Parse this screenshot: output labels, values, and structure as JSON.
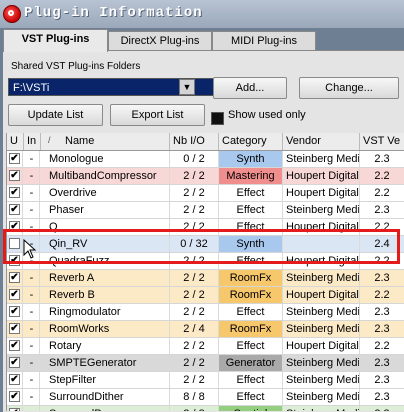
{
  "window": {
    "title": "Plug-in Information"
  },
  "tabs": [
    {
      "label": "VST Plug-ins",
      "active": true
    },
    {
      "label": "DirectX Plug-ins",
      "active": false
    },
    {
      "label": "MIDI Plug-ins",
      "active": false
    }
  ],
  "folders": {
    "label": "Shared VST Plug-ins Folders",
    "selected": "F:\\VSTi",
    "add_label": "Add...",
    "change_label": "Change..."
  },
  "toolbar": {
    "update_label": "Update List",
    "export_label": "Export List",
    "show_used_label": "Show used only"
  },
  "columns": [
    "U",
    "In",
    "Name",
    "Nb I/O",
    "Category",
    "Vendor",
    "VST Ve"
  ],
  "rows": [
    {
      "u": true,
      "in": "-",
      "name": "Monologue",
      "io": "0 / 2",
      "category": "Synth",
      "vendor": "Steinberg Media",
      "ver": "2.3",
      "row_bg": "#ffffff",
      "cat_bg": "#a8c8ee"
    },
    {
      "u": true,
      "in": "-",
      "name": "MultibandCompressor",
      "io": "2 / 2",
      "category": "Mastering",
      "vendor": "Houpert Digital A",
      "ver": "2.2",
      "row_bg": "#f8d7d7",
      "cat_bg": "#f08d8d"
    },
    {
      "u": true,
      "in": "-",
      "name": "Overdrive",
      "io": "2 / 2",
      "category": "Effect",
      "vendor": "Houpert Digital A",
      "ver": "2.2",
      "row_bg": "#ffffff",
      "cat_bg": "#ffffff"
    },
    {
      "u": true,
      "in": "-",
      "name": "Phaser",
      "io": "2 / 2",
      "category": "Effect",
      "vendor": "Steinberg Media",
      "ver": "2.3",
      "row_bg": "#ffffff",
      "cat_bg": "#ffffff"
    },
    {
      "u": true,
      "in": "-",
      "name": "Q",
      "io": "2 / 2",
      "category": "Effect",
      "vendor": "Houpert Digital A",
      "ver": "2.2",
      "row_bg": "#ffffff",
      "cat_bg": "#ffffff"
    },
    {
      "u": false,
      "in": "-",
      "name": "Qin_RV",
      "io": "0 / 32",
      "category": "Synth",
      "vendor": "",
      "ver": "2.4",
      "row_bg": "#dbe6f5",
      "cat_bg": "#a8c8ee"
    },
    {
      "u": true,
      "in": "-",
      "name": "QuadraFuzz",
      "io": "2 / 2",
      "category": "Effect",
      "vendor": "Houpert Digital A",
      "ver": "2.2",
      "row_bg": "#ffffff",
      "cat_bg": "#ffffff"
    },
    {
      "u": true,
      "in": "-",
      "name": "Reverb A",
      "io": "2 / 2",
      "category": "RoomFx",
      "vendor": "Steinberg Media",
      "ver": "2.3",
      "row_bg": "#fce9c6",
      "cat_bg": "#f7c76b"
    },
    {
      "u": true,
      "in": "-",
      "name": "Reverb B",
      "io": "2 / 2",
      "category": "RoomFx",
      "vendor": "Houpert Digital A",
      "ver": "2.2",
      "row_bg": "#fce9c6",
      "cat_bg": "#f7c76b"
    },
    {
      "u": true,
      "in": "-",
      "name": "Ringmodulator",
      "io": "2 / 2",
      "category": "Effect",
      "vendor": "Steinberg Media",
      "ver": "2.3",
      "row_bg": "#ffffff",
      "cat_bg": "#ffffff"
    },
    {
      "u": true,
      "in": "-",
      "name": "RoomWorks",
      "io": "2 / 4",
      "category": "RoomFx",
      "vendor": "Steinberg Media",
      "ver": "2.3",
      "row_bg": "#fce9c6",
      "cat_bg": "#f7c76b"
    },
    {
      "u": true,
      "in": "-",
      "name": "Rotary",
      "io": "2 / 2",
      "category": "Effect",
      "vendor": "Houpert Digital A",
      "ver": "2.2",
      "row_bg": "#ffffff",
      "cat_bg": "#ffffff"
    },
    {
      "u": true,
      "in": "-",
      "name": "SMPTEGenerator",
      "io": "2 / 2",
      "category": "Generator",
      "vendor": "Steinberg Media",
      "ver": "2.3",
      "row_bg": "#d9d9d9",
      "cat_bg": "#a9a9a9"
    },
    {
      "u": true,
      "in": "-",
      "name": "StepFilter",
      "io": "2 / 2",
      "category": "Effect",
      "vendor": "Steinberg Media",
      "ver": "2.3",
      "row_bg": "#ffffff",
      "cat_bg": "#ffffff"
    },
    {
      "u": true,
      "in": "-",
      "name": "SurroundDither",
      "io": "8 / 8",
      "category": "Effect",
      "vendor": "Steinberg Media",
      "ver": "2.3",
      "row_bg": "#ffffff",
      "cat_bg": "#ffffff"
    },
    {
      "u": true,
      "in": "-",
      "name": "SurroundPan",
      "io": "2 / 8",
      "category": "Spatial",
      "vendor": "Steinberg Media",
      "ver": "2.3",
      "row_bg": "#dcefd6",
      "cat_bg": "#93cf7e"
    }
  ]
}
